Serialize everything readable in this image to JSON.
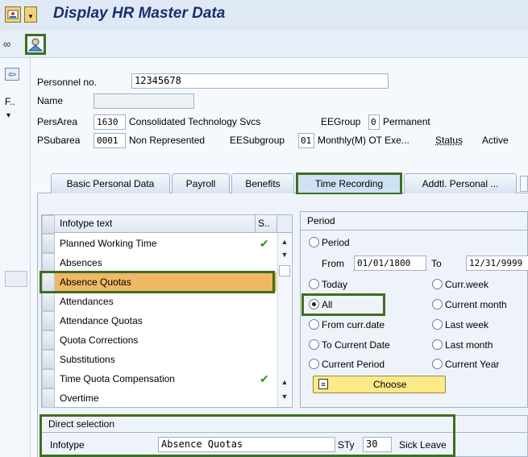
{
  "window": {
    "title": "Display HR Master Data"
  },
  "header": {
    "personnel_no_label": "Personnel no.",
    "personnel_no_value": "12345678",
    "name_label": "Name",
    "name_value": "",
    "persarea_label": "PersArea",
    "persarea_code": "1630",
    "persarea_text": "Consolidated Technology Svcs",
    "eegroup_label": "EEGroup",
    "eegroup_code": "0",
    "eegroup_text": "Permanent",
    "psubarea_label": "PSubarea",
    "psubarea_code": "0001",
    "psubarea_text": "Non Represented",
    "eesubgroup_label": "EESubgroup",
    "eesubgroup_code": "01",
    "eesubgroup_text": "Monthly(M) OT Exe...",
    "status_label": "Status",
    "status_value": "Active"
  },
  "leftstrip": {
    "f_label": "F.."
  },
  "tabs": [
    {
      "label": "Basic Personal Data"
    },
    {
      "label": "Payroll"
    },
    {
      "label": "Benefits"
    },
    {
      "label": "Time Recording"
    },
    {
      "label": "Addtl. Personal ..."
    }
  ],
  "infotype_list": {
    "col_text": "Infotype text",
    "col_s": "S..",
    "rows": [
      {
        "text": "Planned Working Time",
        "check": "✔"
      },
      {
        "text": "Absences",
        "check": ""
      },
      {
        "text": "Absence Quotas",
        "check": ""
      },
      {
        "text": "Attendances",
        "check": ""
      },
      {
        "text": "Attendance Quotas",
        "check": ""
      },
      {
        "text": "Quota Corrections",
        "check": ""
      },
      {
        "text": "Substitutions",
        "check": ""
      },
      {
        "text": "Time Quota Compensation",
        "check": "✔"
      },
      {
        "text": "Overtime",
        "check": ""
      }
    ]
  },
  "period": {
    "title": "Period",
    "period_option": "Period",
    "from_label": "From",
    "from_value": "01/01/1800",
    "to_label": "To",
    "to_value": "12/31/9999",
    "today": "Today",
    "curr_week": "Curr.week",
    "all": "All",
    "current_month": "Current month",
    "from_curr_date": "From curr.date",
    "last_week": "Last week",
    "to_current_date": "To Current Date",
    "last_month": "Last month",
    "current_period": "Current Period",
    "current_year": "Current Year",
    "choose_label": "Choose"
  },
  "direct_selection": {
    "title": "Direct selection",
    "infotype_label": "Infotype",
    "infotype_value": "Absence Quotas",
    "sty_label": "STy",
    "sty_value": "30",
    "sty_text": "Sick Leave"
  },
  "colors": {
    "highlight_row": "#f0b765",
    "annotation_green": "#3f6e20",
    "choose_button": "#fbe98a"
  }
}
